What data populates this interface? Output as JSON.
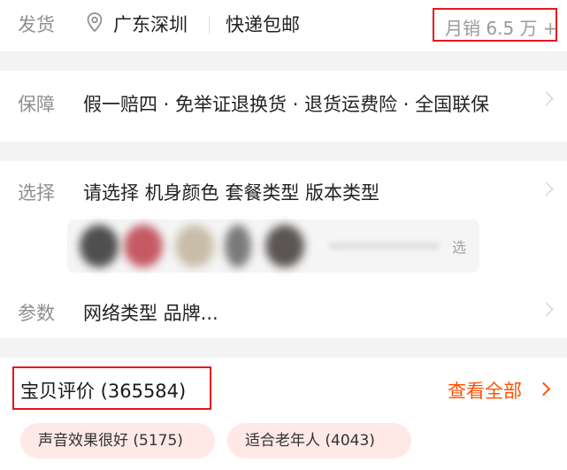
{
  "shipping": {
    "label": "发货",
    "location_icon": "location-pin-icon",
    "location": "广东深圳",
    "free_shipping": "快递包邮",
    "monthly_sales": "月销 6.5 万 +"
  },
  "guarantee": {
    "label": "保障",
    "text": "假一赔四 · 免举证退换货 · 退货运费险 · 全国联保",
    "chevron_icon": "chevron-right-icon"
  },
  "options": {
    "select_label": "选择",
    "select_text": "请选择 机身颜色 套餐类型 版本类型",
    "more_label": "选",
    "param_label": "参数",
    "param_text": "网络类型 品牌...",
    "chevron_icon": "chevron-right-icon"
  },
  "reviews": {
    "title": "宝贝评价 (365584)",
    "view_all": "查看全部",
    "chevron_icon": "chevron-right-icon",
    "tags": [
      {
        "label": "声音效果很好 (5175)"
      },
      {
        "label": "适合老年人 (4043)"
      }
    ]
  },
  "colors": {
    "accent": "#ff5000",
    "highlight_box": "#e6161e",
    "tag_bg": "#ffe9e6",
    "muted_text": "#8f8f8f"
  }
}
